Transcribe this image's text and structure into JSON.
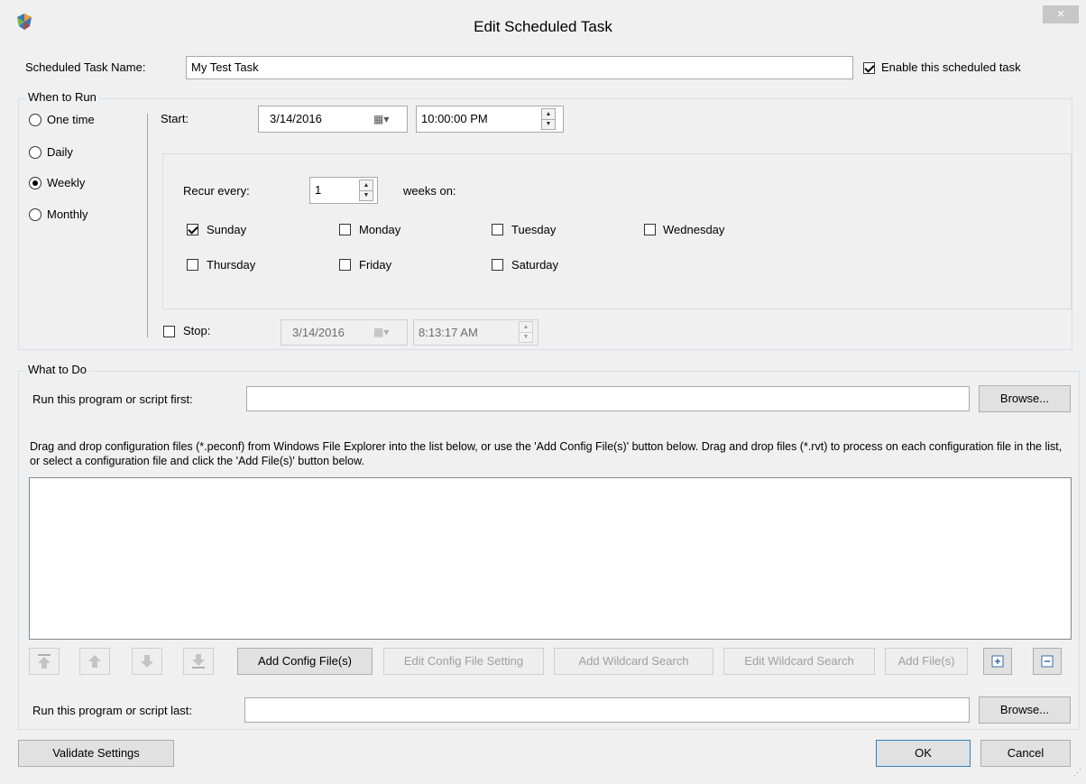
{
  "window": {
    "title": "Edit Scheduled Task",
    "close_glyph": "×",
    "logo_icon": "app-logo-icon"
  },
  "task_name": {
    "label": "Scheduled Task Name:",
    "value": "My Test Task"
  },
  "enable": {
    "label": "Enable this scheduled task",
    "checked": true
  },
  "when_to_run": {
    "legend": "When to Run",
    "frequencies": [
      {
        "label": "One time",
        "selected": false
      },
      {
        "label": "Daily",
        "selected": false
      },
      {
        "label": "Weekly",
        "selected": true
      },
      {
        "label": "Monthly",
        "selected": false
      }
    ],
    "start_label": "Start:",
    "start_date": "3/14/2016",
    "start_time": "10:00:00 PM",
    "recur_label": "Recur every:",
    "recur_value": "1",
    "weeks_on_label": "weeks on:",
    "days": [
      {
        "label": "Sunday",
        "checked": true
      },
      {
        "label": "Monday",
        "checked": false
      },
      {
        "label": "Tuesday",
        "checked": false
      },
      {
        "label": "Wednesday",
        "checked": false
      },
      {
        "label": "Thursday",
        "checked": false
      },
      {
        "label": "Friday",
        "checked": false
      },
      {
        "label": "Saturday",
        "checked": false
      }
    ],
    "stop_label": "Stop:",
    "stop_checked": false,
    "stop_date": "3/14/2016",
    "stop_time": "8:13:17 AM"
  },
  "what_to_do": {
    "legend": "What to Do",
    "run_first_label": "Run this program or script first:",
    "run_first_value": "",
    "browse_label": "Browse...",
    "instructions": "Drag and drop configuration files (*.peconf) from Windows File Explorer into the list below, or use the 'Add Config File(s)' button below.  Drag and drop files (*.rvt) to process on each configuration file in the list, or select a configuration file and click the 'Add File(s)' button below.",
    "file_list_items": [],
    "buttons": {
      "add_config": "Add Config File(s)",
      "edit_config": "Edit  Config  File Setting",
      "add_wildcard": "Add Wildcard Search",
      "edit_wildcard": "Edit Wildcard Search",
      "add_files": "Add File(s)"
    },
    "run_last_label": "Run this program or script last:",
    "run_last_value": ""
  },
  "footer": {
    "validate": "Validate Settings",
    "ok": "OK",
    "cancel": "Cancel"
  }
}
